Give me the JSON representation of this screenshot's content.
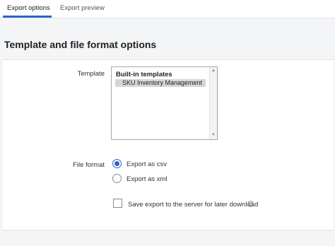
{
  "tabs": [
    {
      "label": "Export options",
      "active": true
    },
    {
      "label": "Export preview",
      "active": false
    }
  ],
  "section_title": "Template and file format options",
  "template": {
    "label": "Template",
    "group_label": "Built-in templates",
    "selected_option": "SKU Inventory Management"
  },
  "file_format": {
    "label": "File format",
    "options": [
      {
        "label": "Export as csv",
        "checked": true
      },
      {
        "label": "Export as xml",
        "checked": false
      }
    ]
  },
  "save_export": {
    "label": "Save export to the server for later download",
    "checked": false
  },
  "colors": {
    "accent": "#2f63c9",
    "background": "#f4f5f7"
  }
}
